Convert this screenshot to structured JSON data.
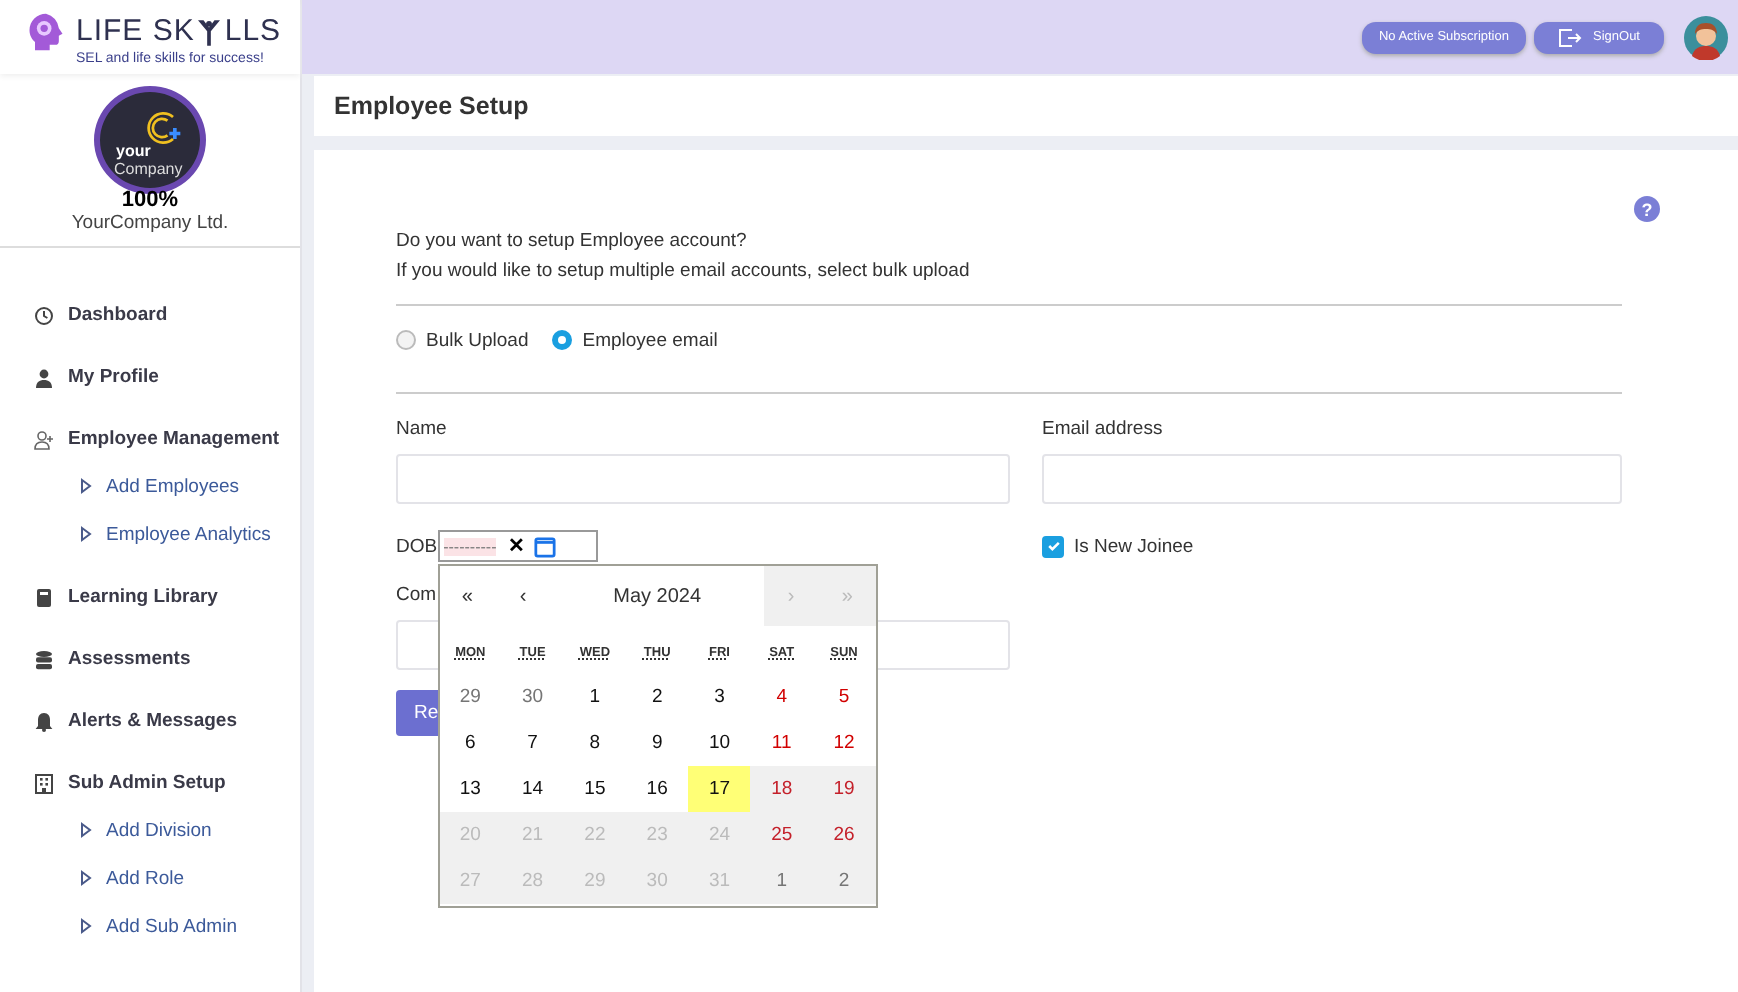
{
  "brand": {
    "before": "LIFE SK",
    "after": "LLS",
    "tagline": "SEL and life skills for success!"
  },
  "company": {
    "logo_top": "your",
    "logo_bottom": "Company",
    "progress": "100%",
    "name": "YourCompany Ltd."
  },
  "sidebar": {
    "items": [
      {
        "label": "Dashboard"
      },
      {
        "label": "My Profile"
      },
      {
        "label": "Employee Management",
        "children": [
          {
            "label": "Add Employees"
          },
          {
            "label": "Employee Analytics"
          }
        ]
      },
      {
        "label": "Learning Library"
      },
      {
        "label": "Assessments"
      },
      {
        "label": "Alerts & Messages"
      },
      {
        "label": "Sub Admin Setup",
        "children": [
          {
            "label": "Add Division"
          },
          {
            "label": "Add Role"
          },
          {
            "label": "Add Sub Admin"
          }
        ]
      }
    ]
  },
  "topbar": {
    "subscription": "No Active Subscription",
    "signout": "SignOut"
  },
  "page": {
    "title": "Employee Setup",
    "help": "?",
    "question": "Do you want to setup Employee account?",
    "hint": "If you would like to setup multiple email accounts, select bulk upload"
  },
  "mode": [
    {
      "label": "Bulk Upload",
      "selected": false
    },
    {
      "label": "Employee email",
      "selected": true
    }
  ],
  "form": {
    "name_label": "Name",
    "email_label": "Email address",
    "dob_label": "DOB",
    "dob_segments": [
      "----",
      "----",
      "--"
    ],
    "dob_clear": "✕",
    "new_joinee": {
      "label": "Is New Joinee",
      "checked": true
    },
    "company_label": "Com",
    "submit": "Re"
  },
  "calendar": {
    "nav": [
      {
        "label": "«",
        "disabled": false
      },
      {
        "label": "‹",
        "disabled": false
      },
      {
        "label": "May 2024",
        "disabled": false
      },
      {
        "label": "›",
        "disabled": true
      },
      {
        "label": "»",
        "disabled": true
      }
    ],
    "weekdays": [
      "MON",
      "TUE",
      "WED",
      "THU",
      "FRI",
      "SAT",
      "SUN"
    ],
    "weeks": [
      [
        {
          "label": "29",
          "kind": "neighbor",
          "disabled": false,
          "current": false
        },
        {
          "label": "30",
          "kind": "neighbor",
          "disabled": false,
          "current": false
        },
        {
          "label": "1",
          "kind": "weekday",
          "disabled": false,
          "current": false
        },
        {
          "label": "2",
          "kind": "weekday",
          "disabled": false,
          "current": false
        },
        {
          "label": "3",
          "kind": "weekday",
          "disabled": false,
          "current": false
        },
        {
          "label": "4",
          "kind": "weekend",
          "disabled": false,
          "current": false
        },
        {
          "label": "5",
          "kind": "weekend",
          "disabled": false,
          "current": false
        }
      ],
      [
        {
          "label": "6",
          "kind": "weekday",
          "disabled": false,
          "current": false
        },
        {
          "label": "7",
          "kind": "weekday",
          "disabled": false,
          "current": false
        },
        {
          "label": "8",
          "kind": "weekday",
          "disabled": false,
          "current": false
        },
        {
          "label": "9",
          "kind": "weekday",
          "disabled": false,
          "current": false
        },
        {
          "label": "10",
          "kind": "weekday",
          "disabled": false,
          "current": false
        },
        {
          "label": "11",
          "kind": "weekend",
          "disabled": false,
          "current": false
        },
        {
          "label": "12",
          "kind": "weekend",
          "disabled": false,
          "current": false
        }
      ],
      [
        {
          "label": "13",
          "kind": "weekday",
          "disabled": false,
          "current": false
        },
        {
          "label": "14",
          "kind": "weekday",
          "disabled": false,
          "current": false
        },
        {
          "label": "15",
          "kind": "weekday",
          "disabled": false,
          "current": false
        },
        {
          "label": "16",
          "kind": "weekday",
          "disabled": false,
          "current": false
        },
        {
          "label": "17",
          "kind": "weekday",
          "disabled": false,
          "current": true
        },
        {
          "label": "18",
          "kind": "weekend",
          "disabled": true,
          "current": false
        },
        {
          "label": "19",
          "kind": "weekend",
          "disabled": true,
          "current": false
        }
      ],
      [
        {
          "label": "20",
          "kind": "weekday",
          "disabled": true,
          "current": false
        },
        {
          "label": "21",
          "kind": "weekday",
          "disabled": true,
          "current": false
        },
        {
          "label": "22",
          "kind": "weekday",
          "disabled": true,
          "current": false
        },
        {
          "label": "23",
          "kind": "weekday",
          "disabled": true,
          "current": false
        },
        {
          "label": "24",
          "kind": "weekday",
          "disabled": true,
          "current": false
        },
        {
          "label": "25",
          "kind": "weekend",
          "disabled": true,
          "current": false
        },
        {
          "label": "26",
          "kind": "weekend",
          "disabled": true,
          "current": false
        }
      ],
      [
        {
          "label": "27",
          "kind": "weekday",
          "disabled": true,
          "current": false
        },
        {
          "label": "28",
          "kind": "weekday",
          "disabled": true,
          "current": false
        },
        {
          "label": "29",
          "kind": "weekday",
          "disabled": true,
          "current": false
        },
        {
          "label": "30",
          "kind": "weekday",
          "disabled": true,
          "current": false
        },
        {
          "label": "31",
          "kind": "weekday",
          "disabled": true,
          "current": false
        },
        {
          "label": "1",
          "kind": "neighbor",
          "disabled": true,
          "current": false
        },
        {
          "label": "2",
          "kind": "neighbor",
          "disabled": true,
          "current": false
        }
      ]
    ]
  }
}
